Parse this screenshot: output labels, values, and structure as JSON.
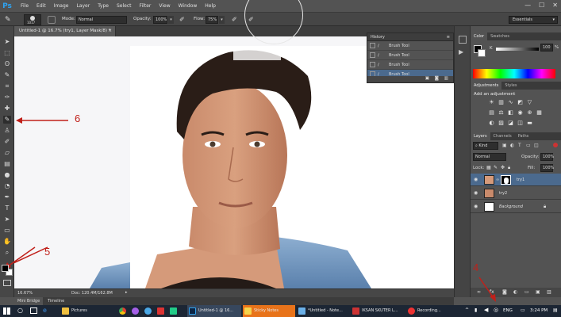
{
  "app": {
    "logo": "Ps"
  },
  "menu": [
    "File",
    "Edit",
    "Image",
    "Layer",
    "Type",
    "Select",
    "Filter",
    "View",
    "Window",
    "Help"
  ],
  "window_controls": {
    "min": "—",
    "max": "☐",
    "close": "✕"
  },
  "options": {
    "brush_size": "1017",
    "mode_label": "Mode:",
    "mode_value": "Normal",
    "opacity_label": "Opacity:",
    "opacity_value": "100%",
    "flow_label": "Flow:",
    "flow_value": "75%",
    "workspace": "Essentials"
  },
  "document_tab": {
    "title": "Untitled-1 @ 16.7% (try1, Layer Mask/8) *",
    "close": "×"
  },
  "status": {
    "zoom": "16.67%",
    "doc": "Doc: 120.4M/162.8M"
  },
  "mini_bridge": {
    "tabs": [
      "Mini Bridge",
      "Timeline"
    ]
  },
  "history": {
    "title": "History",
    "items": [
      "Brush Tool",
      "Brush Tool",
      "Brush Tool",
      "Brush Tool"
    ]
  },
  "color_panel": {
    "tabs": [
      "Color",
      "Swatches"
    ],
    "k_label": "K",
    "k_value": "100",
    "k_unit": "%"
  },
  "adjustments": {
    "tabs": [
      "Adjustments",
      "Styles"
    ],
    "heading": "Add an adjustment"
  },
  "layers": {
    "tabs": [
      "Layers",
      "Channels",
      "Paths"
    ],
    "filter": "Kind",
    "blend": "Normal",
    "opacity_label": "Opacity:",
    "opacity_value": "100%",
    "lock_label": "Lock:",
    "fill_label": "Fill:",
    "fill_value": "100%",
    "items": [
      {
        "name": "try1"
      },
      {
        "name": "try2"
      },
      {
        "name": "Background"
      }
    ]
  },
  "annotations": [
    "6",
    "5",
    "4"
  ],
  "taskbar": {
    "items": [
      "Pictures",
      "Untitled-1 @ 16...",
      "Sticky Notes",
      "*Untitled - Note...",
      "IKSAN SKUTER L...",
      "Recording..."
    ],
    "lang": "ENG",
    "time": "3:24 PM"
  },
  "colors": {
    "accent_red": "#c0201a",
    "ps_blue": "#2fa3f0",
    "layer_selected": "#4b6a8e"
  }
}
